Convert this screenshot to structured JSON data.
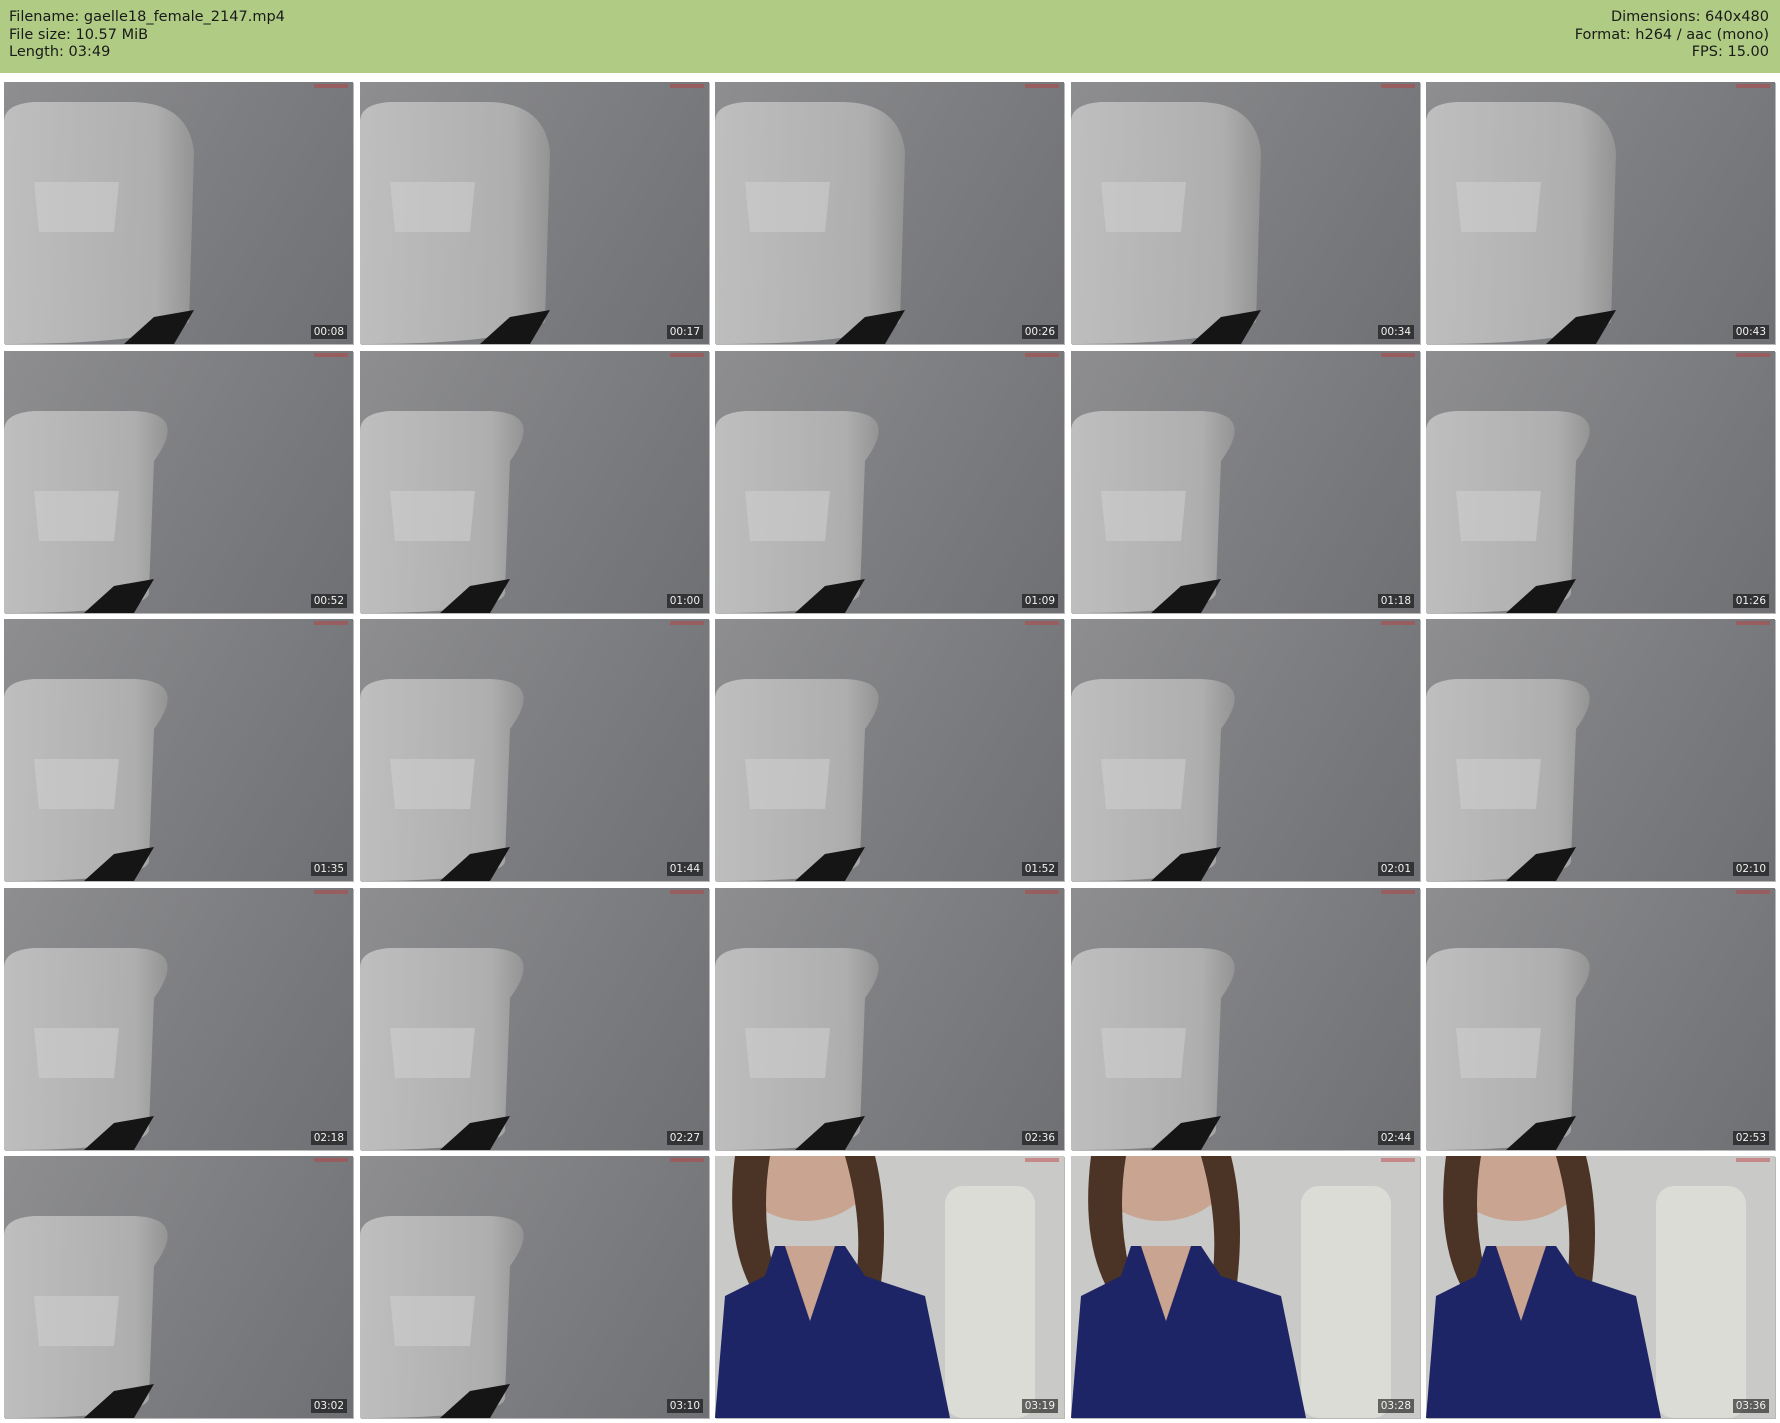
{
  "header": {
    "filename": "Filename: gaelle18_female_2147.mp4",
    "file_size": "File size: 10.57 MiB",
    "length": "Length: 03:49",
    "dimensions": "Dimensions: 640x480",
    "format": "Format: h264 / aac (mono)",
    "fps": "FPS: 15.00"
  },
  "colors": {
    "header_bg": "#b0cc84",
    "page_bg": "#ffffff"
  },
  "thumbnails": [
    {
      "time": "00:08",
      "scene": "chair"
    },
    {
      "time": "00:17",
      "scene": "chair"
    },
    {
      "time": "00:26",
      "scene": "chair"
    },
    {
      "time": "00:34",
      "scene": "chair"
    },
    {
      "time": "00:43",
      "scene": "chair"
    },
    {
      "time": "00:52",
      "scene": "chair"
    },
    {
      "time": "01:00",
      "scene": "chair"
    },
    {
      "time": "01:09",
      "scene": "chair"
    },
    {
      "time": "01:18",
      "scene": "chair"
    },
    {
      "time": "01:26",
      "scene": "chair"
    },
    {
      "time": "01:35",
      "scene": "chair"
    },
    {
      "time": "01:44",
      "scene": "chair"
    },
    {
      "time": "01:52",
      "scene": "chair"
    },
    {
      "time": "02:01",
      "scene": "chair"
    },
    {
      "time": "02:10",
      "scene": "chair"
    },
    {
      "time": "02:18",
      "scene": "chair"
    },
    {
      "time": "02:27",
      "scene": "chair"
    },
    {
      "time": "02:36",
      "scene": "chair"
    },
    {
      "time": "02:44",
      "scene": "chair"
    },
    {
      "time": "02:53",
      "scene": "chair"
    },
    {
      "time": "03:02",
      "scene": "chair"
    },
    {
      "time": "03:10",
      "scene": "chair"
    },
    {
      "time": "03:19",
      "scene": "person"
    },
    {
      "time": "03:28",
      "scene": "person"
    },
    {
      "time": "03:36",
      "scene": "person"
    }
  ]
}
